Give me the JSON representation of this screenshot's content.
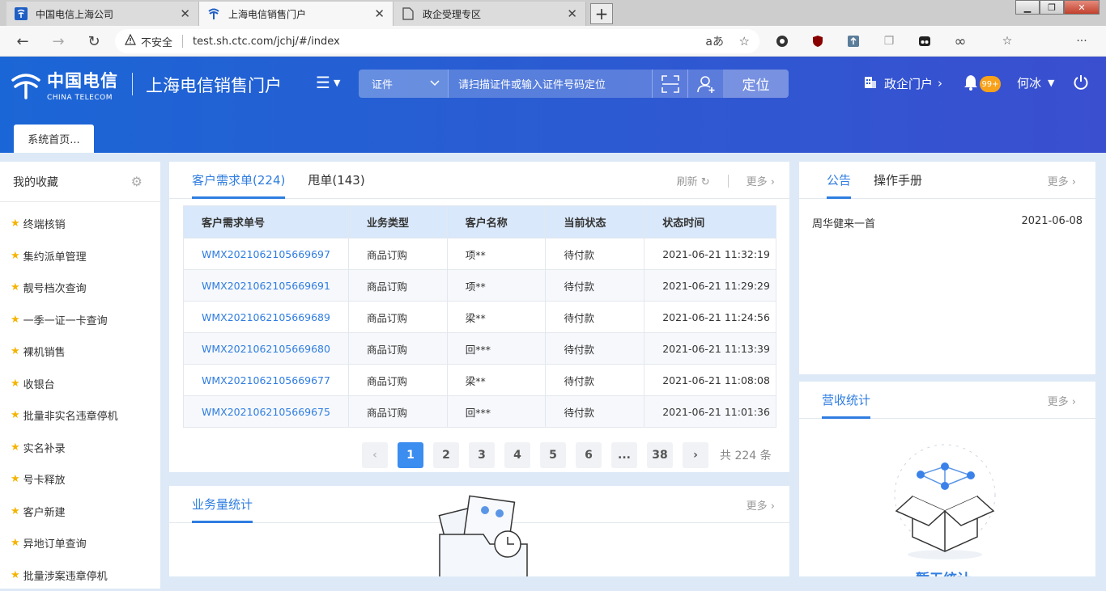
{
  "browser": {
    "tabs": [
      {
        "title": "中国电信上海公司",
        "active": false
      },
      {
        "title": "上海电信销售门户",
        "active": true
      },
      {
        "title": "政企受理专区",
        "active": false
      }
    ],
    "insecure_label": "不安全",
    "url": "test.sh.ctc.com/jchj/#/index"
  },
  "header": {
    "logo_cn": "中国电信",
    "logo_en": "CHINA TELECOM",
    "portal_title": "上海电信销售门户",
    "search": {
      "type_label": "证件",
      "placeholder": "请扫描证件或输入证件号码定位",
      "locate_label": "定位"
    },
    "gov_portal_label": "政企门户",
    "notification_badge": "99+",
    "user_name": "何冰",
    "system_tab": "系统首页..."
  },
  "sidebar": {
    "title": "我的收藏",
    "items": [
      "终端核销",
      "集约派单管理",
      "靓号档次查询",
      "一季一证一卡查询",
      "裸机销售",
      "收银台",
      "批量非实名违章停机",
      "实名补录",
      "号卡释放",
      "客户新建",
      "异地订单查询",
      "批量涉案违章停机"
    ]
  },
  "orders_panel": {
    "tabs": [
      {
        "label": "客户需求单(224)",
        "active": true
      },
      {
        "label": "甩单(143)",
        "active": false
      }
    ],
    "refresh_label": "刷新",
    "more_label": "更多",
    "columns": [
      "客户需求单号",
      "业务类型",
      "客户名称",
      "当前状态",
      "状态时间"
    ],
    "rows": [
      [
        "WMX2021062105669697",
        "商品订购",
        "项**",
        "待付款",
        "2021-06-21 11:32:19"
      ],
      [
        "WMX2021062105669691",
        "商品订购",
        "项**",
        "待付款",
        "2021-06-21 11:29:29"
      ],
      [
        "WMX2021062105669689",
        "商品订购",
        "梁**",
        "待付款",
        "2021-06-21 11:24:56"
      ],
      [
        "WMX2021062105669680",
        "商品订购",
        "回***",
        "待付款",
        "2021-06-21 11:13:39"
      ],
      [
        "WMX2021062105669677",
        "商品订购",
        "梁**",
        "待付款",
        "2021-06-21 11:08:08"
      ],
      [
        "WMX2021062105669675",
        "商品订购",
        "回***",
        "待付款",
        "2021-06-21 11:01:36"
      ]
    ],
    "pager": {
      "pages": [
        "1",
        "2",
        "3",
        "4",
        "5",
        "6",
        "...",
        "38"
      ],
      "current": "1",
      "total_label": "共 224 条"
    }
  },
  "volume_panel": {
    "title": "业务量统计",
    "more_label": "更多"
  },
  "notice_panel": {
    "tabs": [
      {
        "label": "公告",
        "active": true
      },
      {
        "label": "操作手册",
        "active": false
      }
    ],
    "more_label": "更多",
    "items": [
      {
        "title": "周华健来一首",
        "date": "2021-06-08"
      }
    ]
  },
  "revenue_panel": {
    "title": "营收统计",
    "more_label": "更多",
    "empty_text": "暂无统计"
  },
  "colors": {
    "primary": "#2f7de1",
    "header_gradient_start": "#1b66d6",
    "header_gradient_end": "#3a4fd0",
    "star": "#f5b400",
    "badge": "#f8a21b"
  }
}
